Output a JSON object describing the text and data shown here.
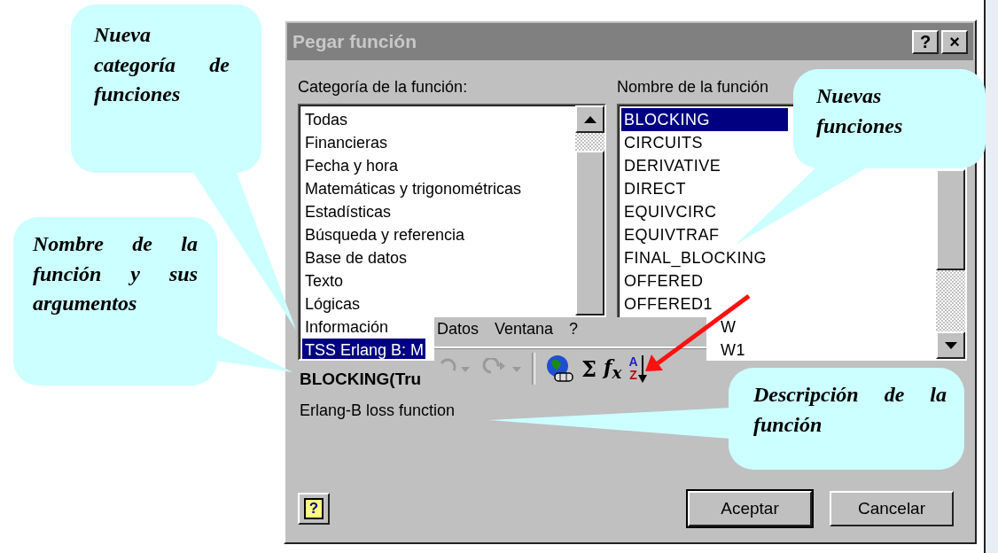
{
  "window": {
    "title": "Pegar función",
    "title_buttons": [
      "?",
      "×"
    ]
  },
  "category_label": "Categoría de la función:",
  "categories": [
    {
      "label": "Todas",
      "selected": false
    },
    {
      "label": "Financieras",
      "selected": false
    },
    {
      "label": "Fecha y hora",
      "selected": false
    },
    {
      "label": "Matemáticas y trigonométricas",
      "selected": false
    },
    {
      "label": "Estadísticas",
      "selected": false
    },
    {
      "label": "Búsqueda y referencia",
      "selected": false
    },
    {
      "label": "Base de datos",
      "selected": false
    },
    {
      "label": "Texto",
      "selected": false
    },
    {
      "label": "Lógicas",
      "selected": false
    },
    {
      "label": "Información",
      "selected": false
    },
    {
      "label": "TSS Erlang B: M",
      "selected": true
    }
  ],
  "function_label": "Nombre de la función",
  "functions": [
    {
      "label": "BLOCKING",
      "selected": true,
      "kind": "plain"
    },
    {
      "label": "CIRCUITS",
      "selected": false,
      "kind": "plain"
    },
    {
      "label": "DERIVATIVE",
      "selected": false,
      "kind": "plain"
    },
    {
      "label": "DIRECT",
      "selected": false,
      "kind": "plain"
    },
    {
      "label": "EQUIVCIRC",
      "selected": false,
      "kind": "plain"
    },
    {
      "label": "EQUIVTRAF",
      "selected": false,
      "kind": "plain"
    },
    {
      "label": "FINAL_BLOCKING",
      "selected": false,
      "kind": "plain"
    },
    {
      "label": "OFFERED",
      "selected": false,
      "kind": "plain"
    },
    {
      "label": "OFFERED1",
      "selected": false,
      "kind": "plain"
    },
    {
      "label": "W",
      "selected": false,
      "kind": "covered"
    },
    {
      "label": "W1",
      "selected": false,
      "kind": "covered"
    }
  ],
  "syntax": "BLOCKING(Tru",
  "description": "Erlang-B loss function",
  "help_button": "?",
  "buttons": [
    {
      "label": "Aceptar",
      "default": true
    },
    {
      "label": "Cancelar",
      "default": false
    }
  ],
  "toolbar": {
    "menus": [
      "Datos",
      "Ventana",
      "?"
    ],
    "buttons": [
      {
        "kind": "undo",
        "disabled": true
      },
      {
        "kind": "redo",
        "disabled": true
      },
      {
        "kind": "globe",
        "disabled": false
      },
      {
        "kind": "sum",
        "label": "Σ",
        "disabled": false
      },
      {
        "kind": "function",
        "label": "f$_{x}$",
        "disabled": false
      },
      {
        "kind": "sort",
        "label": "A",
        "label2": "Z",
        "disabled": false
      }
    ]
  },
  "callouts": [
    {
      "text": "Nueva categoría de funciones"
    },
    {
      "text": "Nuevas funciones"
    },
    {
      "text": "Nombre de la función y sus argumentos"
    },
    {
      "text": "Descripción de la función"
    }
  ]
}
